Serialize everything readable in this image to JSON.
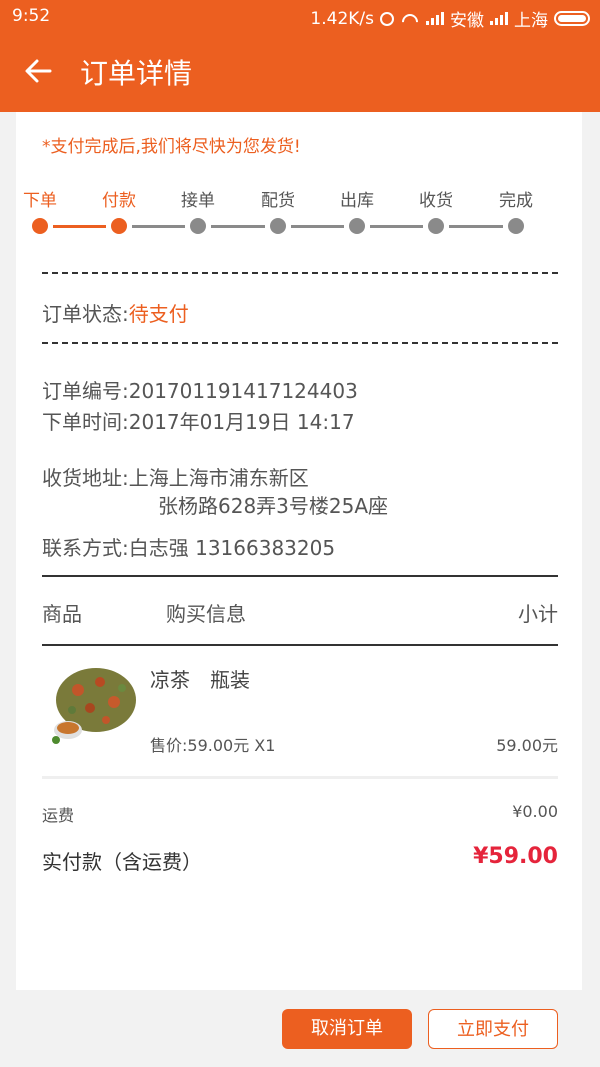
{
  "status_bar": {
    "time": "9:52",
    "speed": "1.42K/s",
    "carrier1": "安徽",
    "carrier2": "上海"
  },
  "header": {
    "title": "订单详情",
    "back_icon": "arrow-left-icon",
    "color": "#ec5f20"
  },
  "notice": "*支付完成后,我们将尽快为您发货!",
  "steps": [
    {
      "label": "下单",
      "active": true
    },
    {
      "label": "付款",
      "active": true
    },
    {
      "label": "接单",
      "active": false
    },
    {
      "label": "配货",
      "active": false
    },
    {
      "label": "出库",
      "active": false
    },
    {
      "label": "收货",
      "active": false
    },
    {
      "label": "完成",
      "active": false
    }
  ],
  "order": {
    "status_label": "订单状态:",
    "status_value": "待支付",
    "number_label": "订单编号:",
    "number_value": "20170119141712440​3",
    "time_label": "下单时间:",
    "time_value": "2017年01月19日 14:17",
    "address_label": "收货地址:",
    "address_line1": "上海上海市浦东新区",
    "address_line2": "张杨路628弄3号楼25A座",
    "contact_label": "联系方式:",
    "contact_value": "白志强  13166383205"
  },
  "table": {
    "col_goods": "商品",
    "col_info": "购买信息",
    "col_subtotal": "小计"
  },
  "product": {
    "name": "凉茶　瓶装",
    "price_line": "售价:59.00元    X1",
    "subtotal": "59.00元"
  },
  "summary": {
    "shipping_label": "运费",
    "shipping_value": "¥0.00",
    "total_label": "实付款（含运费）",
    "total_value": "¥59.00",
    "total_color": "#e5243b"
  },
  "buttons": {
    "cancel": "取消订单",
    "pay": "立即支付"
  }
}
